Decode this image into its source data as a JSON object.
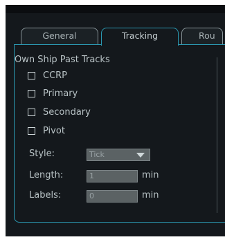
{
  "tabs": [
    {
      "label": "General",
      "active": false
    },
    {
      "label": "Tracking",
      "active": true
    },
    {
      "label": "Rou",
      "active": false
    }
  ],
  "section": {
    "title": "Own Ship Past Tracks"
  },
  "checkboxes": [
    {
      "label": "CCRP",
      "checked": false
    },
    {
      "label": "Primary",
      "checked": false
    },
    {
      "label": "Secondary",
      "checked": false
    },
    {
      "label": "Pivot",
      "checked": false
    }
  ],
  "style": {
    "label": "Style:",
    "value": "Tick"
  },
  "length": {
    "label": "Length:",
    "value": "1",
    "unit": "min"
  },
  "labels": {
    "label": "Labels:",
    "value": "0",
    "unit": "min"
  },
  "colors": {
    "accent": "#2b9ab3",
    "background": "#14181c"
  }
}
